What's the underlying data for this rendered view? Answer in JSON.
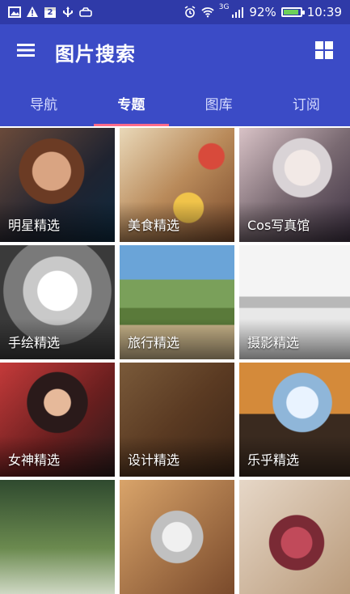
{
  "status_bar": {
    "left_icons": [
      "image-icon",
      "warning-icon",
      "calendar-icon",
      "usb-icon",
      "controller-icon"
    ],
    "calendar_day": "2",
    "right_icons": [
      "alarm-icon",
      "wifi-icon",
      "signal-icon",
      "battery-icon"
    ],
    "network_label": "3G",
    "battery_percent_text": "92%",
    "battery_level": 0.92,
    "time": "10:39"
  },
  "app_bar": {
    "title": "图片搜索"
  },
  "tabs": [
    {
      "label": "导航"
    },
    {
      "label": "专题",
      "active": true
    },
    {
      "label": "图库"
    },
    {
      "label": "订阅"
    }
  ],
  "tiles": [
    {
      "label": "明星精选"
    },
    {
      "label": "美食精选"
    },
    {
      "label": "Cos写真馆"
    },
    {
      "label": "手绘精选"
    },
    {
      "label": "旅行精选"
    },
    {
      "label": "摄影精选"
    },
    {
      "label": "女神精选"
    },
    {
      "label": "设计精选"
    },
    {
      "label": "乐乎精选"
    },
    {
      "label": ""
    },
    {
      "label": ""
    },
    {
      "label": ""
    }
  ],
  "colors": {
    "status_bar": "#2f3aa8",
    "app_bar": "#3b4bc6",
    "active_tab_indicator": "#ff6b8a"
  }
}
